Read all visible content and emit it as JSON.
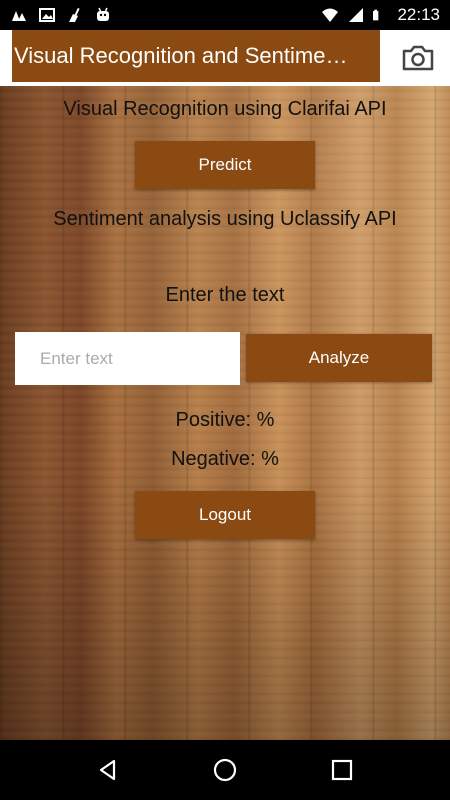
{
  "status_bar": {
    "time": "22:13",
    "icons_left": [
      "notification-icon",
      "image-icon",
      "broom-icon",
      "android-icon"
    ],
    "icons_right": [
      "wifi-icon",
      "signal-icon",
      "battery-icon"
    ]
  },
  "app_bar": {
    "title": "Visual Recognition and Sentime…",
    "action_icon": "camera-icon"
  },
  "main": {
    "visual_heading": "Visual Recognition using Clarifai API",
    "predict_label": "Predict",
    "sentiment_heading": "Sentiment analysis using Uclassify API",
    "enter_heading": "Enter the text",
    "text_input": {
      "value": "",
      "placeholder": "Enter text"
    },
    "analyze_label": "Analyze",
    "positive_text": "Positive: %",
    "negative_text": "Negative: %",
    "logout_label": "Logout"
  },
  "nav_bar": {
    "buttons": [
      "back-icon",
      "home-icon",
      "recents-icon"
    ]
  },
  "colors": {
    "accent": "#8a4a12",
    "status_bg": "#000000",
    "app_bar_bg": "#ffffff"
  }
}
